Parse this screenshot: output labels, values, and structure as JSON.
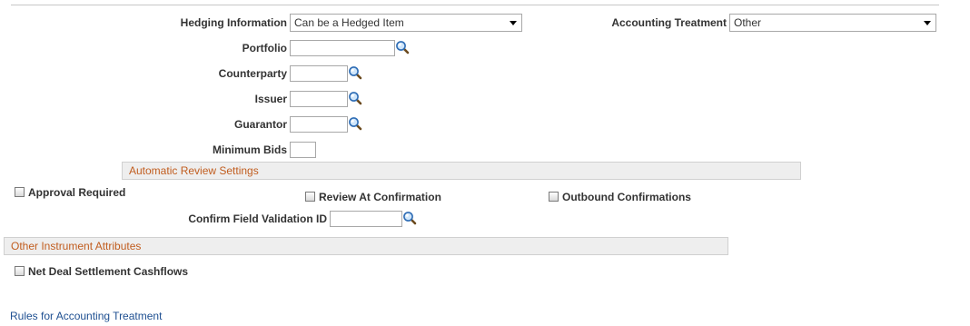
{
  "form": {
    "hedging_information": {
      "label": "Hedging Information",
      "value": "Can be a Hedged Item"
    },
    "accounting_treatment": {
      "label": "Accounting Treatment",
      "value": "Other"
    },
    "portfolio": {
      "label": "Portfolio",
      "value": ""
    },
    "counterparty": {
      "label": "Counterparty",
      "value": ""
    },
    "issuer": {
      "label": "Issuer",
      "value": ""
    },
    "guarantor": {
      "label": "Guarantor",
      "value": ""
    },
    "minimum_bids": {
      "label": "Minimum Bids",
      "value": ""
    }
  },
  "auto_review": {
    "title": "Automatic Review Settings",
    "approval_required": {
      "label": "Approval Required",
      "checked": false
    },
    "review_at_confirmation": {
      "label": "Review At Confirmation",
      "checked": false
    },
    "outbound_confirmations": {
      "label": "Outbound Confirmations",
      "checked": false
    },
    "confirm_field_validation": {
      "label": "Confirm Field Validation ID",
      "value": ""
    }
  },
  "other_attributes": {
    "title": "Other Instrument Attributes",
    "net_deal_settlement": {
      "label": "Net Deal Settlement Cashflows",
      "checked": false
    }
  },
  "links": {
    "rules_accounting": "Rules for Accounting Treatment"
  },
  "icons": {
    "lookup": "magnifier-lookup-icon",
    "dropdown": "dropdown-arrow-icon",
    "checkbox": "checkbox-icon"
  },
  "colors": {
    "section_title": "#c15d1f",
    "link": "#1e4f91",
    "section_bg": "#eeeeee"
  }
}
